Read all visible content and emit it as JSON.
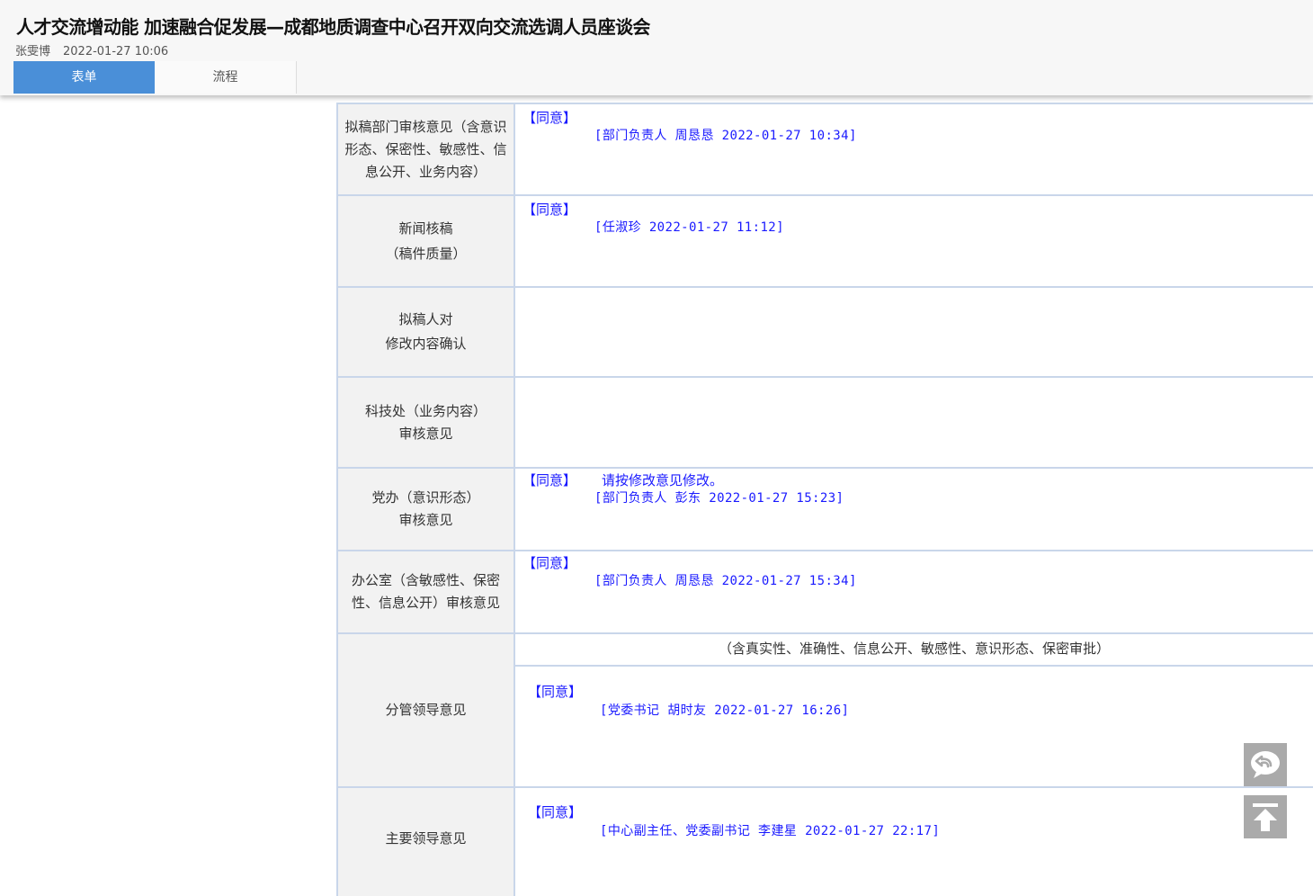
{
  "header": {
    "title": "人才交流增动能 加速融合促发展—成都地质调查中心召开双向交流选调人员座谈会",
    "author": "张雯博",
    "datetime": "2022-01-27 10:06"
  },
  "tabs": [
    {
      "label": "表单",
      "active": true
    },
    {
      "label": "流程",
      "active": false
    }
  ],
  "rows": [
    {
      "label": "拟稿部门审核意见（含意识形态、保密性、敏感性、信息公开、业务内容）",
      "agree": "【同意】",
      "comment": "",
      "sign": "[部门负责人 周恳恳 2022-01-27 10:34]"
    },
    {
      "label": "新闻核稿（稿件质量）",
      "label_line1": "新闻核稿",
      "label_line2": "（稿件质量）",
      "agree": "【同意】",
      "comment": "",
      "sign": "[任淑珍 2022-01-27 11:12]"
    },
    {
      "label_line1": "拟稿人对",
      "label_line2": "修改内容确认",
      "agree": "",
      "comment": "",
      "sign": ""
    },
    {
      "label_line1": "科技处（业务内容）",
      "label_line2": "审核意见",
      "agree": "",
      "comment": "",
      "sign": ""
    },
    {
      "label_line1": "党办（意识形态）",
      "label_line2": "审核意见",
      "agree": "【同意】",
      "comment": "请按修改意见修改。",
      "sign": "[部门负责人 彭东 2022-01-27 15:23]"
    },
    {
      "label": "办公室（含敏感性、保密性、信息公开）审核意见",
      "agree": "【同意】",
      "comment": "",
      "sign": "[部门负责人 周恳恳 2022-01-27 15:34]"
    },
    {
      "label": "分管领导意见",
      "note": "（含真实性、准确性、信息公开、敏感性、意识形态、保密审批）",
      "agree": "【同意】",
      "comment": "",
      "sign": "[党委书记 胡时友 2022-01-27 16:26]"
    },
    {
      "label": "主要领导意见",
      "agree": "【同意】",
      "comment": "",
      "sign": "[中心副主任、党委副书记 李建星 2022-01-27 22:17]"
    }
  ],
  "floating": {
    "comment_icon": "comment-bubble-icon",
    "top_icon": "back-to-top-icon"
  }
}
